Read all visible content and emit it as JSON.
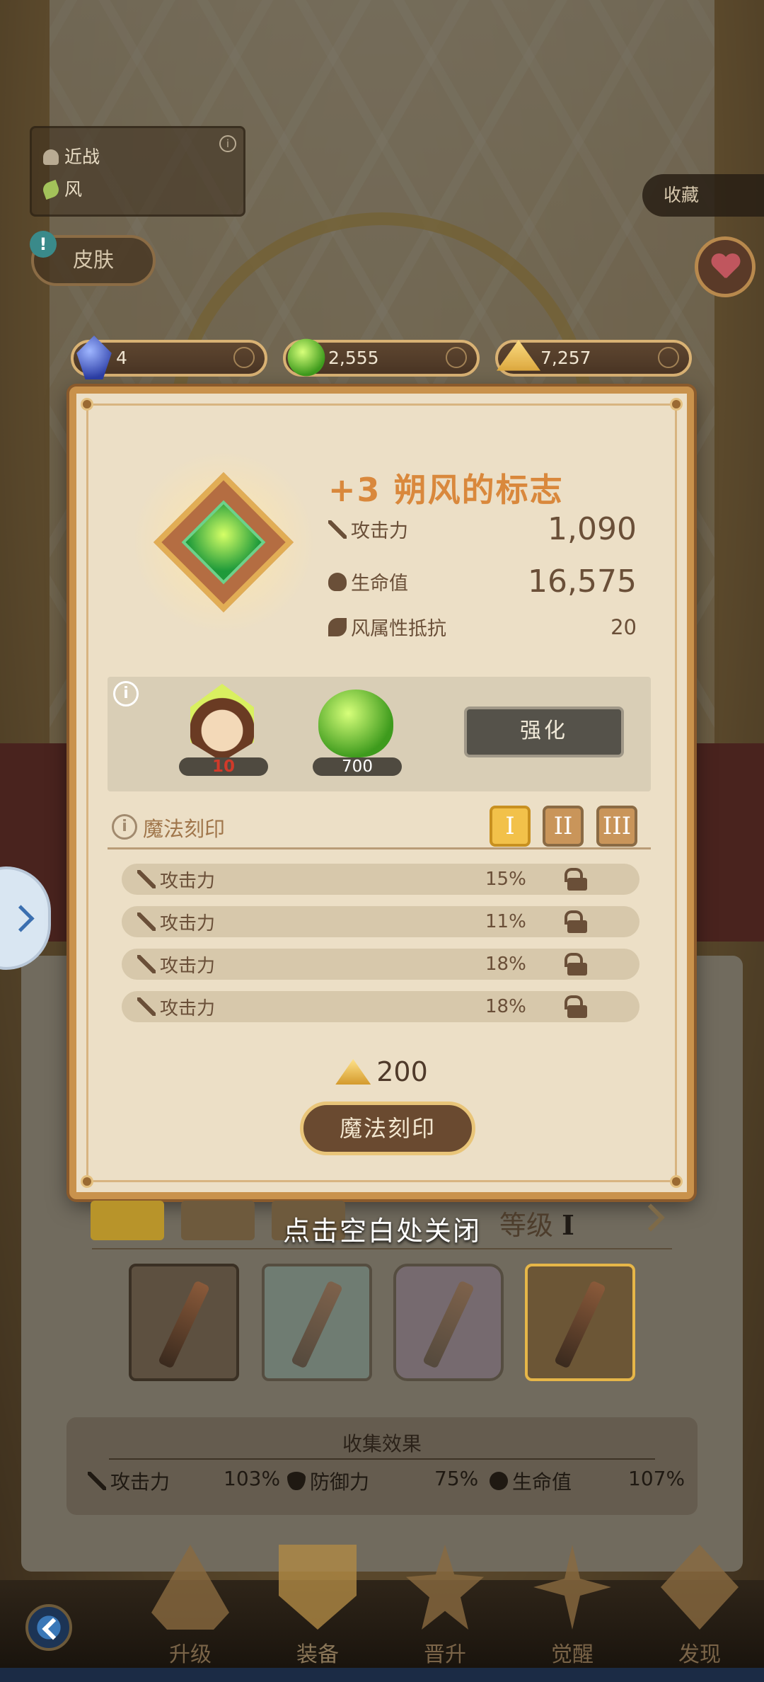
{
  "header": {
    "class_attack_type": "近战",
    "class_element": "风",
    "skin_label": "皮肤",
    "alert_mark": "!",
    "info_mark": "i",
    "collect_label": "收藏"
  },
  "currencies": [
    {
      "icon": "blue-gem-icon",
      "value": "4"
    },
    {
      "icon": "green-slime-icon",
      "value": "2,555"
    },
    {
      "icon": "gold-pile-icon",
      "value": "7,257"
    }
  ],
  "modal": {
    "title": "+3 朔风的标志",
    "stats": [
      {
        "icon": "sword-icon",
        "label": "攻击力",
        "value": "1,090"
      },
      {
        "icon": "heart-shield-icon",
        "label": "生命值",
        "value": "16,575"
      },
      {
        "icon": "wind-icon",
        "label": "风属性抵抗",
        "value": "20"
      }
    ],
    "upgrade": {
      "hero_level": "10",
      "material_count": "700",
      "enhance_label": "强化"
    },
    "rune": {
      "title": "魔法刻印",
      "tiers": [
        "I",
        "II",
        "III"
      ],
      "active_tier": "I",
      "rows": [
        {
          "label": "攻击力",
          "value": "15%"
        },
        {
          "label": "攻击力",
          "value": "11%"
        },
        {
          "label": "攻击力",
          "value": "18%"
        },
        {
          "label": "攻击力",
          "value": "18%"
        }
      ],
      "cost": "200",
      "button_label": "魔法刻印"
    }
  },
  "close_hint": "点击空白处关闭",
  "grade": {
    "label": "等级",
    "value": "I"
  },
  "collection": {
    "title": "收集效果",
    "stats": [
      {
        "icon": "sword-icon",
        "label": "攻击力",
        "value": "103%"
      },
      {
        "icon": "shield-icon",
        "label": "防御力",
        "value": "75%"
      },
      {
        "icon": "heart-icon",
        "label": "生命值",
        "value": "107%"
      }
    ]
  },
  "nav": {
    "items": [
      {
        "label": "升级",
        "icon": "upgrade-icon"
      },
      {
        "label": "装备",
        "icon": "equipment-icon",
        "active": true
      },
      {
        "label": "晋升",
        "icon": "promote-icon"
      },
      {
        "label": "觉醒",
        "icon": "awaken-icon"
      },
      {
        "label": "发现",
        "icon": "discover-icon"
      }
    ]
  },
  "colors": {
    "accent_orange": "#d9883c",
    "panel_border": "#c9924c",
    "active_tier": "#f2c14a"
  }
}
